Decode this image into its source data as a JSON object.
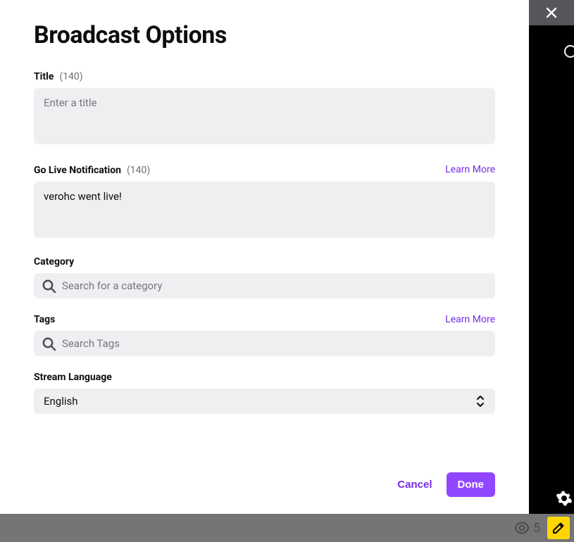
{
  "modal": {
    "title": "Broadcast Options",
    "title_field": {
      "label": "Title",
      "count": "(140)",
      "placeholder": "Enter a title",
      "value": ""
    },
    "notification_field": {
      "label": "Go Live Notification",
      "count": "(140)",
      "learn": "Learn More",
      "value": "verohc went live!"
    },
    "category_field": {
      "label": "Category",
      "placeholder": "Search for a category",
      "value": ""
    },
    "tags_field": {
      "label": "Tags",
      "learn": "Learn More",
      "placeholder": "Search Tags",
      "value": ""
    },
    "language_field": {
      "label": "Stream Language",
      "selected": "English"
    },
    "actions": {
      "cancel": "Cancel",
      "done": "Done"
    }
  },
  "bottom": {
    "viewers": "5"
  }
}
